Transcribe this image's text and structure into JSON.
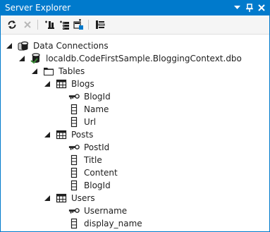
{
  "window": {
    "title": "Server Explorer",
    "accent_color": "#007acc"
  },
  "title_controls": [
    {
      "name": "dropdown-arrow-icon"
    },
    {
      "name": "pin-icon"
    },
    {
      "name": "close-icon"
    }
  ],
  "toolbar": [
    {
      "name": "refresh-icon"
    },
    {
      "name": "stop-icon"
    },
    {
      "name": "connect-to-database-icon"
    },
    {
      "name": "connect-to-server-icon"
    },
    {
      "name": "connect-to-sharepoint-icon"
    },
    {
      "name": "properties-icon"
    }
  ],
  "tree": [
    {
      "label": "Data Connections",
      "icon": "database-connections-icon",
      "level": 0,
      "expanded": true
    },
    {
      "label": "localdb.CodeFirstSample.BloggingContext.dbo",
      "icon": "database-icon",
      "level": 1,
      "expanded": true
    },
    {
      "label": "Tables",
      "icon": "folder-icon",
      "level": 2,
      "expanded": true
    },
    {
      "label": "Blogs",
      "icon": "table-icon",
      "level": 3,
      "expanded": true
    },
    {
      "label": "BlogId",
      "icon": "primary-key-icon",
      "level": 4
    },
    {
      "label": "Name",
      "icon": "column-icon",
      "level": 4
    },
    {
      "label": "Url",
      "icon": "column-icon",
      "level": 4
    },
    {
      "label": "Posts",
      "icon": "table-icon",
      "level": 3,
      "expanded": true
    },
    {
      "label": "PostId",
      "icon": "primary-key-icon",
      "level": 4
    },
    {
      "label": "Title",
      "icon": "column-icon",
      "level": 4
    },
    {
      "label": "Content",
      "icon": "column-icon",
      "level": 4
    },
    {
      "label": "BlogId",
      "icon": "column-icon",
      "level": 4
    },
    {
      "label": "Users",
      "icon": "table-icon",
      "level": 3,
      "expanded": true
    },
    {
      "label": "Username",
      "icon": "primary-key-icon",
      "level": 4
    },
    {
      "label": "display_name",
      "icon": "column-icon",
      "level": 4
    }
  ]
}
